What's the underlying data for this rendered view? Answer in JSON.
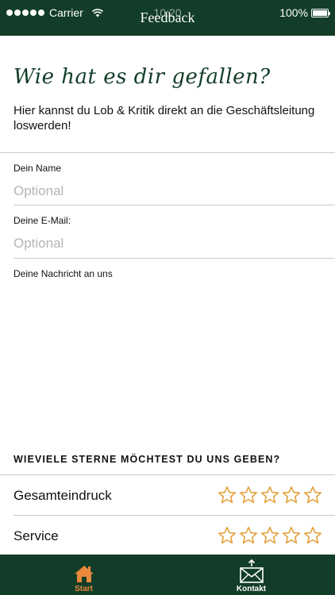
{
  "status_bar": {
    "carrier": "Carrier",
    "time": "10:20",
    "battery": "100%"
  },
  "nav": {
    "title": "Feedback"
  },
  "intro": {
    "headline": "Wie hat es dir gefallen?",
    "text": "Hier kannst du Lob & Kritik direkt an die Geschäftsleitung loswerden!"
  },
  "form": {
    "name_label": "Dein Name",
    "name_placeholder": "Optional",
    "name_value": "",
    "email_label": "Deine E-Mail:",
    "email_placeholder": "Optional",
    "email_value": "",
    "message_label": "Deine Nachricht an uns",
    "message_value": ""
  },
  "rating": {
    "heading": "WIEVIELE STERNE MÖCHTEST DU UNS GEBEN?",
    "max_stars": 5,
    "items": [
      {
        "label": "Gesamteindruck",
        "value": 0
      },
      {
        "label": "Service",
        "value": 0
      }
    ]
  },
  "tabbar": {
    "tabs": [
      {
        "label": "Start",
        "icon": "home-icon",
        "active": true
      },
      {
        "label": "Kontakt",
        "icon": "envelope-icon",
        "active": false
      }
    ]
  },
  "colors": {
    "brand_green": "#123d28",
    "accent_orange": "#e8893b",
    "star_outline": "#e3a23c",
    "placeholder_gray": "#b5b5b5",
    "divider_gray": "#c9c9c9"
  }
}
